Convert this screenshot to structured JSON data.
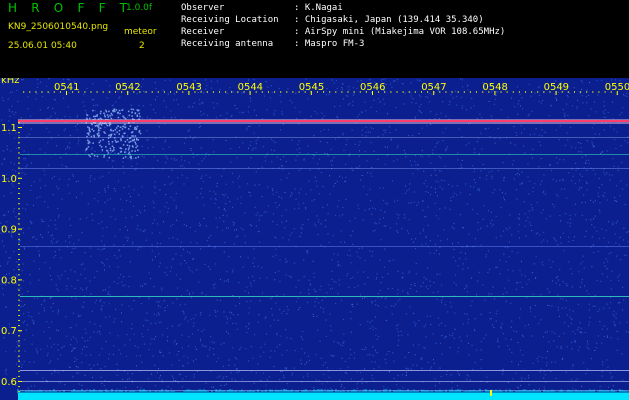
{
  "header": {
    "app_title": "H R O F F T",
    "app_version": "1.0.0f",
    "file_name": "KN9_2506010540.png",
    "meteor_label": "meteor",
    "date_time": "25.06.01 05:40",
    "meteor_count": "2",
    "info": [
      {
        "label": "Observer",
        "value": ": K.Nagai"
      },
      {
        "label": "Receiving Location",
        "value": ": Chigasaki, Japan (139.414 35.340)"
      },
      {
        "label": "Receiver",
        "value": ": AirSpy mini (Miakejima VOR 108.65MHz)"
      },
      {
        "label": "Receiving antenna",
        "value": ": Maspro FM-3"
      }
    ]
  },
  "plot": {
    "y_unit": "kHz",
    "y_ticks": [
      "1.1",
      "1.0",
      "0.9",
      "0.8",
      "0.7",
      "0.6"
    ],
    "time_ticks": [
      "0541",
      "0542",
      "0543",
      "0544",
      "0545",
      "0546",
      "0547",
      "0548",
      "0549",
      "0550"
    ],
    "colors": {
      "background": "#0b1f8e",
      "noise": "#2f5fe0",
      "carrier": "#ff3c6e",
      "carrier_glow": "#ffd2e6",
      "trace": "#34e0c6",
      "axis_text": "#ffff00",
      "baseline": "#00e5ff"
    }
  }
}
